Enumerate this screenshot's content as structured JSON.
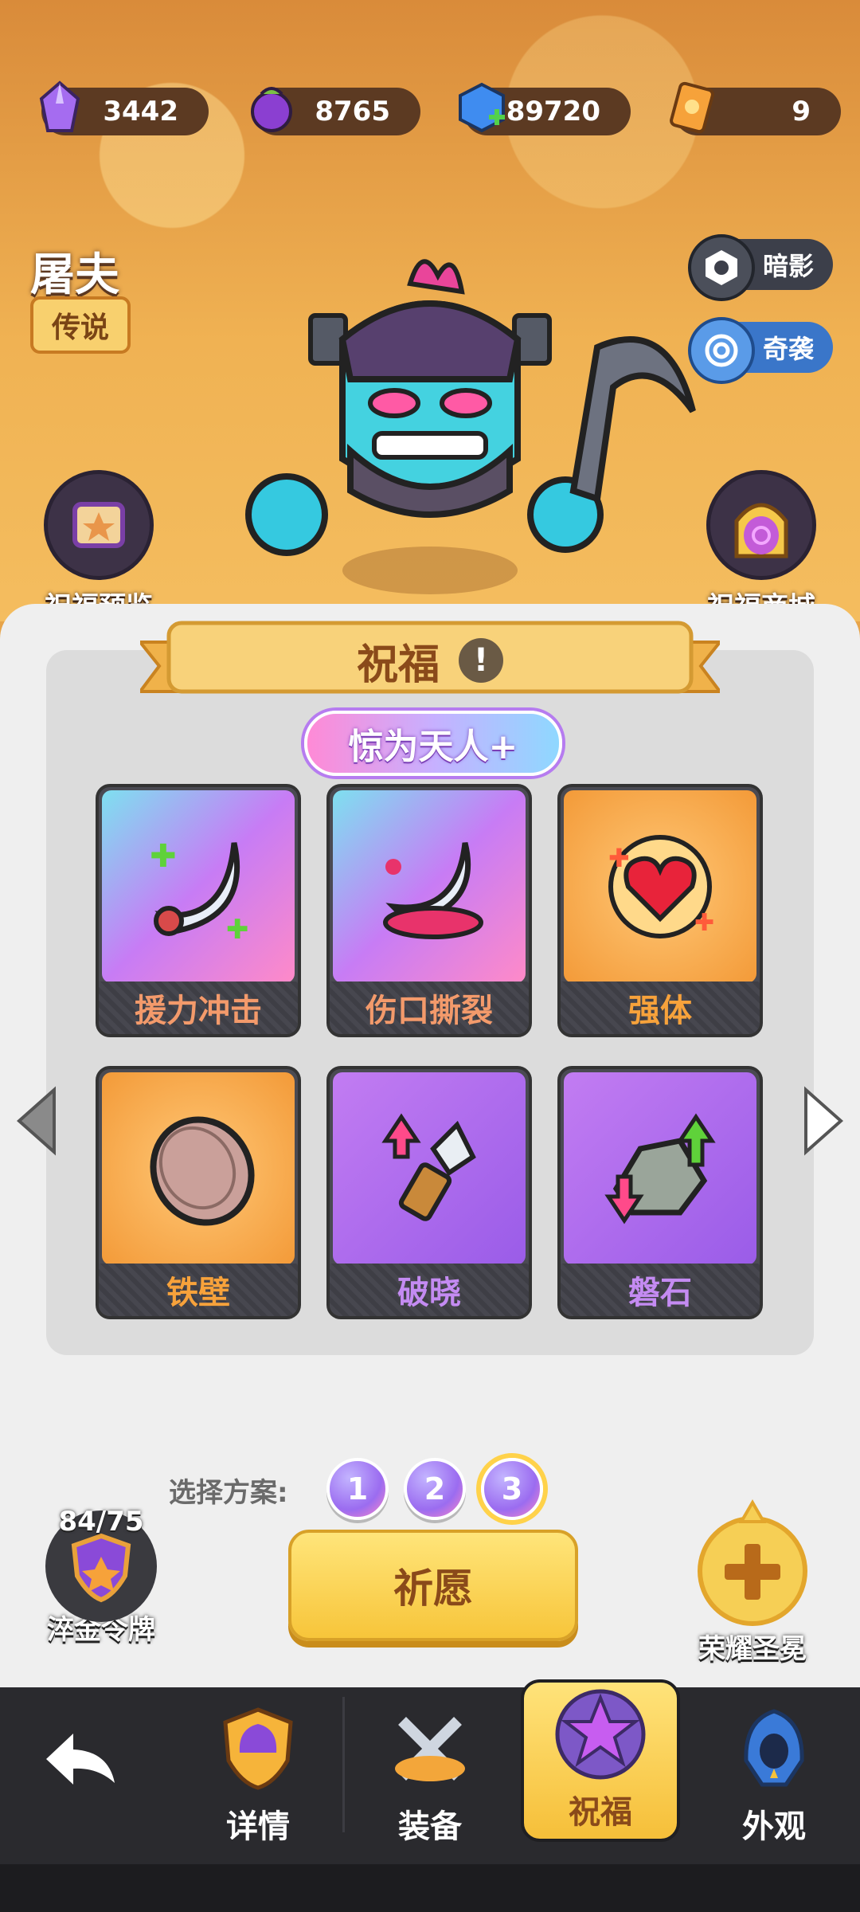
{
  "resources": [
    {
      "name": "crystal",
      "value": "3442",
      "icon": "purple-crystal-icon"
    },
    {
      "name": "potion",
      "value": "8765",
      "icon": "green-potion-icon"
    },
    {
      "name": "gem",
      "value": "89720",
      "icon": "blue-gem-plus-icon"
    },
    {
      "name": "ticket",
      "value": "9",
      "icon": "orange-ticket-icon"
    }
  ],
  "hero": {
    "name": "屠夫",
    "rarity": "传说"
  },
  "tags": [
    {
      "label": "暗影",
      "icon": "shadow-icon"
    },
    {
      "label": "奇袭",
      "icon": "swirl-icon"
    }
  ],
  "side_buttons": {
    "preview": "祝福预览",
    "shop": "祝福商城"
  },
  "blessing": {
    "title": "祝福",
    "set_name": "惊为天人+",
    "cards": [
      {
        "label": "援力冲击",
        "color": "#f39a6b",
        "theme": "rainbow",
        "icon": "crescent-blade-icon"
      },
      {
        "label": "伤口撕裂",
        "color": "#f39a6b",
        "theme": "rainbow",
        "icon": "bloody-blade-icon"
      },
      {
        "label": "强体",
        "color": "#f7a23b",
        "theme": "orange",
        "icon": "heart-burst-icon"
      },
      {
        "label": "铁壁",
        "color": "#f7a23b",
        "theme": "orange",
        "icon": "shield-icon"
      },
      {
        "label": "破晓",
        "color": "#c48bf2",
        "theme": "purple",
        "icon": "dagger-up-icon"
      },
      {
        "label": "磐石",
        "color": "#c48bf2",
        "theme": "purple",
        "icon": "rock-arrows-icon"
      }
    ]
  },
  "plan": {
    "label": "选择方案:",
    "options": [
      "1",
      "2",
      "3"
    ],
    "selected": "3"
  },
  "pray_button": "祈愿",
  "token": {
    "count": "84/75",
    "label": "淬金令牌"
  },
  "glory": {
    "label": "荣耀圣冕"
  },
  "nav": {
    "back_icon": "back-arrow-icon",
    "items": [
      {
        "label": "详情",
        "icon": "helmet-icon"
      },
      {
        "label": "装备",
        "icon": "crossed-swords-icon"
      },
      {
        "label": "祝福",
        "icon": "purple-star-icon",
        "active": true
      },
      {
        "label": "外观",
        "icon": "hood-icon"
      }
    ]
  }
}
